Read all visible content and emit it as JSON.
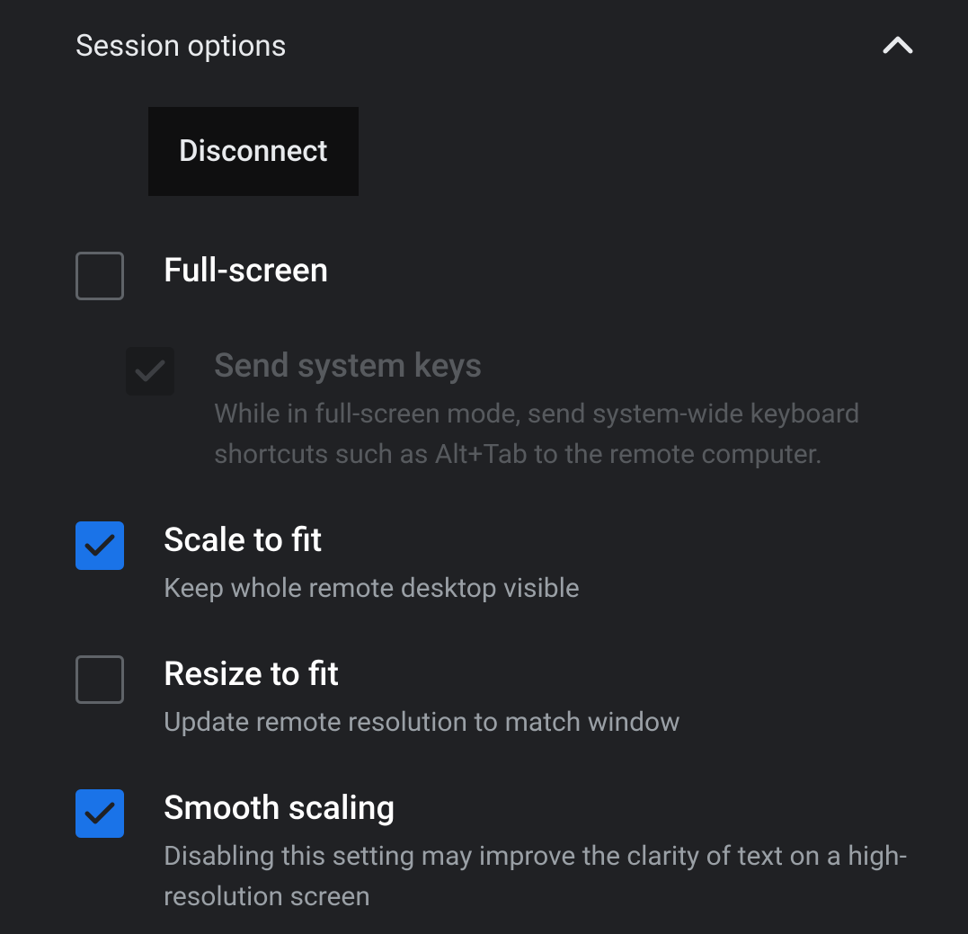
{
  "header": {
    "title": "Session options"
  },
  "actions": {
    "disconnect_label": "Disconnect"
  },
  "options": {
    "fullscreen": {
      "label": "Full-screen",
      "checked": false
    },
    "send_system_keys": {
      "label": "Send system keys",
      "description": "While in full-screen mode, send system-wide keyboard shortcuts such as Alt+Tab to the remote computer.",
      "checked": true,
      "disabled": true
    },
    "scale_to_fit": {
      "label": "Scale to fit",
      "description": "Keep whole remote desktop visible",
      "checked": true
    },
    "resize_to_fit": {
      "label": "Resize to fit",
      "description": "Update remote resolution to match window",
      "checked": false
    },
    "smooth_scaling": {
      "label": "Smooth scaling",
      "description": "Disabling this setting may improve the clarity of text on a high-resolution screen",
      "checked": true
    }
  }
}
